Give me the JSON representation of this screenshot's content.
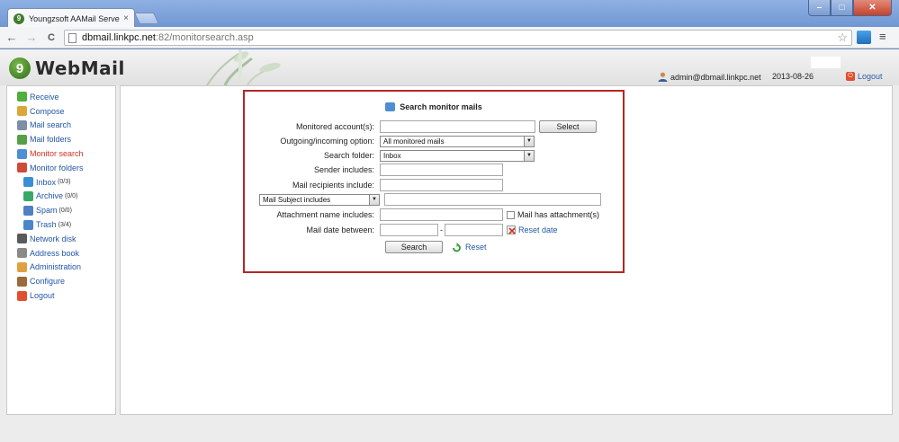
{
  "browser": {
    "tab_title": "Youngzsoft AAMail Server",
    "tab_close": "×",
    "url_host": "dbmail.linkpc.net",
    "url_path": ":82/monitorsearch.asp",
    "back": "←",
    "forward": "→",
    "reload": "C",
    "star": "☆",
    "menu": "≡",
    "win_min": "–",
    "win_max": "□",
    "win_close": "✕"
  },
  "header": {
    "logo_mark": "9",
    "logo_text": "WebMail",
    "user": "admin@dbmail.linkpc.net",
    "date": "2013-08-26",
    "logout": "Logout"
  },
  "sidebar": {
    "items": [
      {
        "label": "Receive",
        "icon": "receive-icon",
        "color": "#4fae3c"
      },
      {
        "label": "Compose",
        "icon": "compose-icon",
        "color": "#d9a73a"
      },
      {
        "label": "Mail search",
        "icon": "magnifier-icon",
        "color": "#7c8fa6"
      },
      {
        "label": "Mail folders",
        "icon": "folders-icon",
        "color": "#55a046"
      },
      {
        "label": "Monitor search",
        "icon": "monitor-search-icon",
        "color": "#4d8ed4",
        "active": true
      },
      {
        "label": "Monitor folders",
        "icon": "monitor-folders-icon",
        "color": "#d04a3a"
      },
      {
        "label": "Inbox",
        "count": "(0/3)",
        "icon": "inbox-icon",
        "color": "#3a8ed6",
        "sub": true
      },
      {
        "label": "Archive",
        "count": "(0/0)",
        "icon": "archive-icon",
        "color": "#3aa76a",
        "sub": true
      },
      {
        "label": "Spam",
        "count": "(0/0)",
        "icon": "spam-icon",
        "color": "#4f7fc4",
        "sub": true
      },
      {
        "label": "Trash",
        "count": "(3/4)",
        "icon": "trash-icon",
        "color": "#4a86c8",
        "sub": true
      },
      {
        "label": "Network disk",
        "icon": "network-disk-icon",
        "color": "#5a5a5a"
      },
      {
        "label": "Address book",
        "icon": "address-book-icon",
        "color": "#8a8a8a"
      },
      {
        "label": "Administration",
        "icon": "administration-icon",
        "color": "#e0a040"
      },
      {
        "label": "Configure",
        "icon": "configure-icon",
        "color": "#9a6a3a"
      },
      {
        "label": "Logout",
        "icon": "logout-icon",
        "color": "#e0502e"
      }
    ]
  },
  "search": {
    "title": "Search monitor mails",
    "monitored_label": "Monitored account(s):",
    "select_button": "Select",
    "direction_label": "Outgoing/incoming option:",
    "direction_value": "All monitored mails",
    "folder_label": "Search folder:",
    "folder_value": "Inbox",
    "sender_label": "Sender includes:",
    "recipients_label": "Mail recipients include:",
    "subject_option": "Mail Subject includes",
    "attachment_label": "Attachment name includes:",
    "has_attachment_label": "Mail has attachment(s)",
    "date_label": "Mail date between:",
    "date_separator": "-",
    "reset_date": "Reset date",
    "search_button": "Search",
    "reset": "Reset",
    "dropdown_arrow": "▼"
  }
}
